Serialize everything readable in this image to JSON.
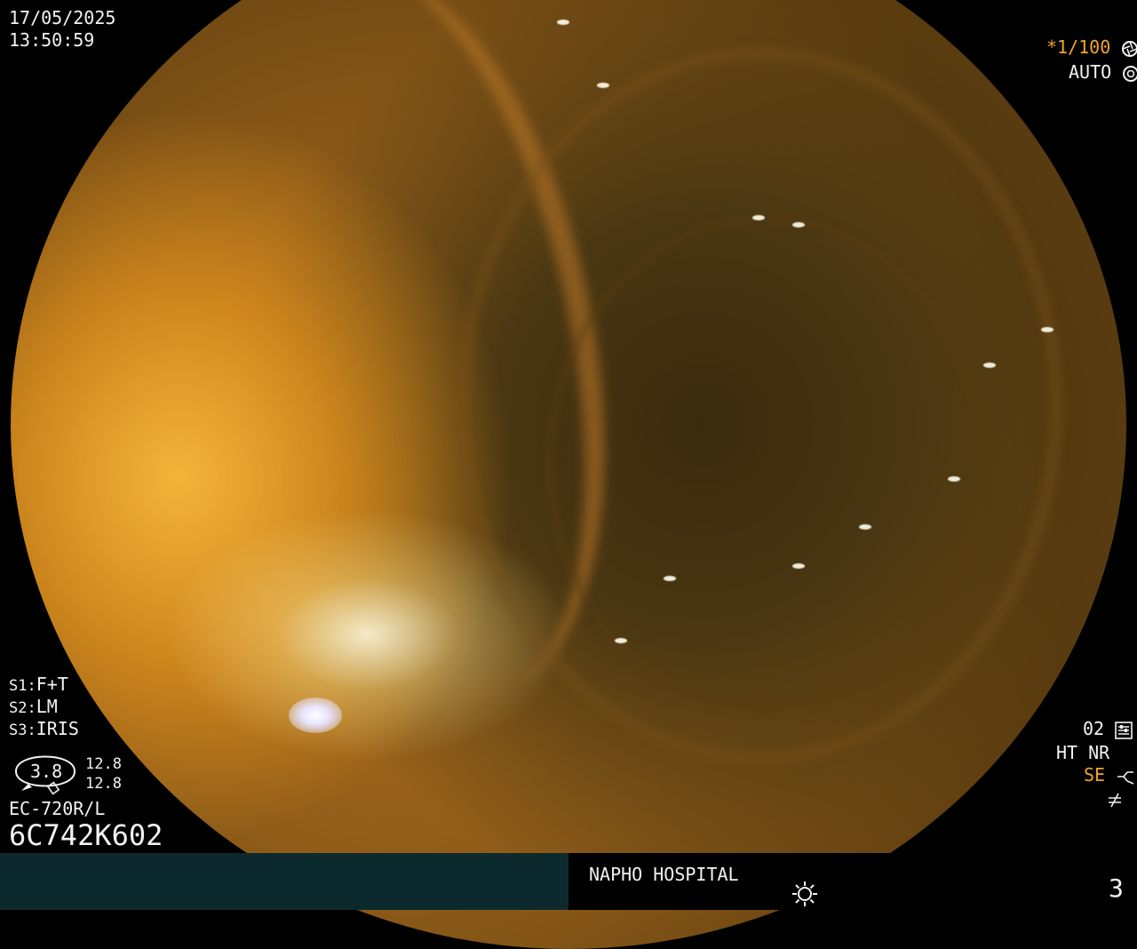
{
  "datetime": {
    "date": "17/05/2025",
    "time": "13:50:59"
  },
  "shutter": {
    "value": "*1/100",
    "icon": "shutter-icon"
  },
  "exposure": {
    "mode": "AUTO",
    "icon": "aperture-icon"
  },
  "settings": {
    "s1_label": "S1:",
    "s1_value": "F+T",
    "s2_label": "S2:",
    "s2_value": "LM",
    "s3_label": "S3:",
    "s3_value": "IRIS"
  },
  "iris": {
    "center_value": "3.8",
    "upper_value": "12.8",
    "lower_value": "12.8"
  },
  "scope": {
    "model": "EC-720R/L",
    "serial": "6C742K602"
  },
  "right_panel": {
    "mode_value": "02",
    "mode_icon": "settings-sliders-icon",
    "ht": "HT",
    "nr": "NR",
    "se": "SE",
    "se_icon": "pump-icon",
    "freeze_icon": "not-equal-icon"
  },
  "footer": {
    "hospital": "NAPHO HOSPITAL",
    "lamp_icon": "lamp-icon",
    "page": "3"
  },
  "colors": {
    "accent": "#f0a428",
    "footer_bar": "#0c2a2e",
    "text": "#f2f2f2"
  }
}
